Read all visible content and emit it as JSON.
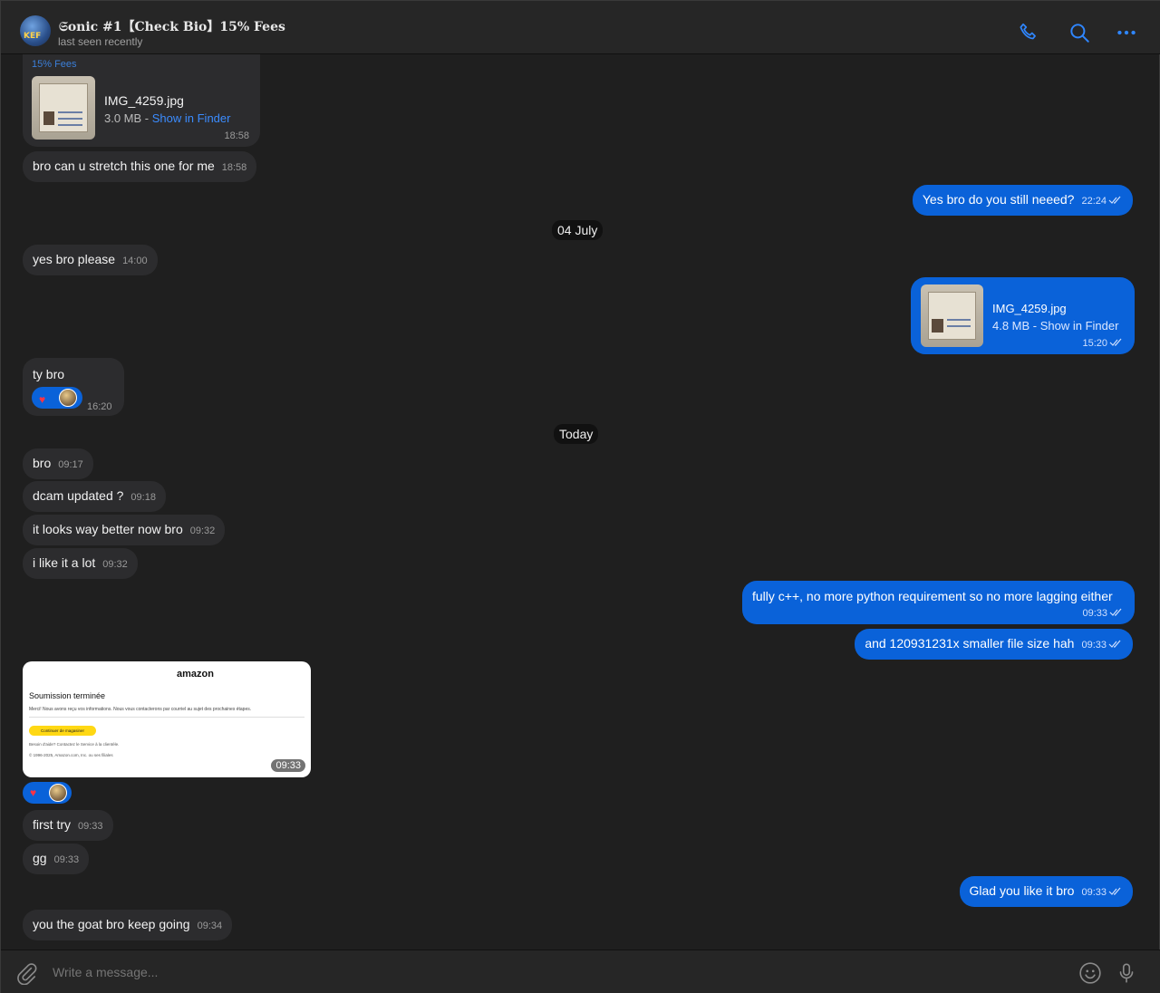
{
  "header": {
    "title": "𝔖onic #1【Check Bio】15% Fees",
    "status": "last seen recently",
    "avatar_badge": "KEF"
  },
  "messages": {
    "forwarded_caption": "15% Fees",
    "file1": {
      "name": "IMG_4259.jpg",
      "size": "3.0 MB - ",
      "finder": "Show in Finder",
      "time": "18:58"
    },
    "m1": {
      "text": "bro can u stretch this one for me",
      "time": "18:58"
    },
    "m2": {
      "text": "Yes bro do you still neeed?",
      "time": "22:24"
    },
    "date1": "04 July",
    "m3": {
      "text": "yes bro please",
      "time": "14:00"
    },
    "file2": {
      "name": "IMG_4259.jpg",
      "size": "4.8 MB - Show in Finder",
      "time": "15:20"
    },
    "m4": {
      "text": "ty bro",
      "time": "16:20"
    },
    "date2": "Today",
    "m5": {
      "text": "bro",
      "time": "09:17"
    },
    "m6": {
      "text": "dcam updated ?",
      "time": "09:18"
    },
    "m7": {
      "text": "it looks way better now bro",
      "time": "09:32"
    },
    "m8": {
      "text": "i like it a lot",
      "time": "09:32"
    },
    "m9": {
      "text": "fully c++, no more python requirement so no more lagging either",
      "time": "09:33"
    },
    "m10": {
      "text": "and 120931231x smaller file size hah",
      "time": "09:33"
    },
    "screenshot": {
      "logo": "amazon",
      "heading": "Soumission terminée",
      "paragraph": "Merci! Nous avons reçu vos informations. Nous vous contacterons par courriel au sujet des prochaines étapes.",
      "button": "Continuer de magasiner",
      "help": "Besoin d'aide? Contactez le Service à la clientèle.",
      "copyright": "© 1996-2025, Amazon.com, Inc. ou ses filiales",
      "time": "09:33"
    },
    "m11": {
      "text": "first try",
      "time": "09:33"
    },
    "m12": {
      "text": "gg",
      "time": "09:33"
    },
    "m13": {
      "text": "Glad you like it bro",
      "time": "09:33"
    },
    "m14": {
      "text": "you the goat bro keep going",
      "time": "09:34"
    },
    "reaction_emoji": "♥"
  },
  "composer": {
    "placeholder": "Write a message..."
  },
  "icons": {
    "call": "phone-icon",
    "search": "search-icon",
    "more": "more-dots-icon",
    "attach": "paperclip-icon",
    "emoji": "emoji-icon",
    "mic": "microphone-icon",
    "read": "double-check-icon"
  },
  "colors": {
    "accent": "#0a62d9",
    "background": "#1f1f1f",
    "incoming_bubble": "#2c2c2e"
  }
}
